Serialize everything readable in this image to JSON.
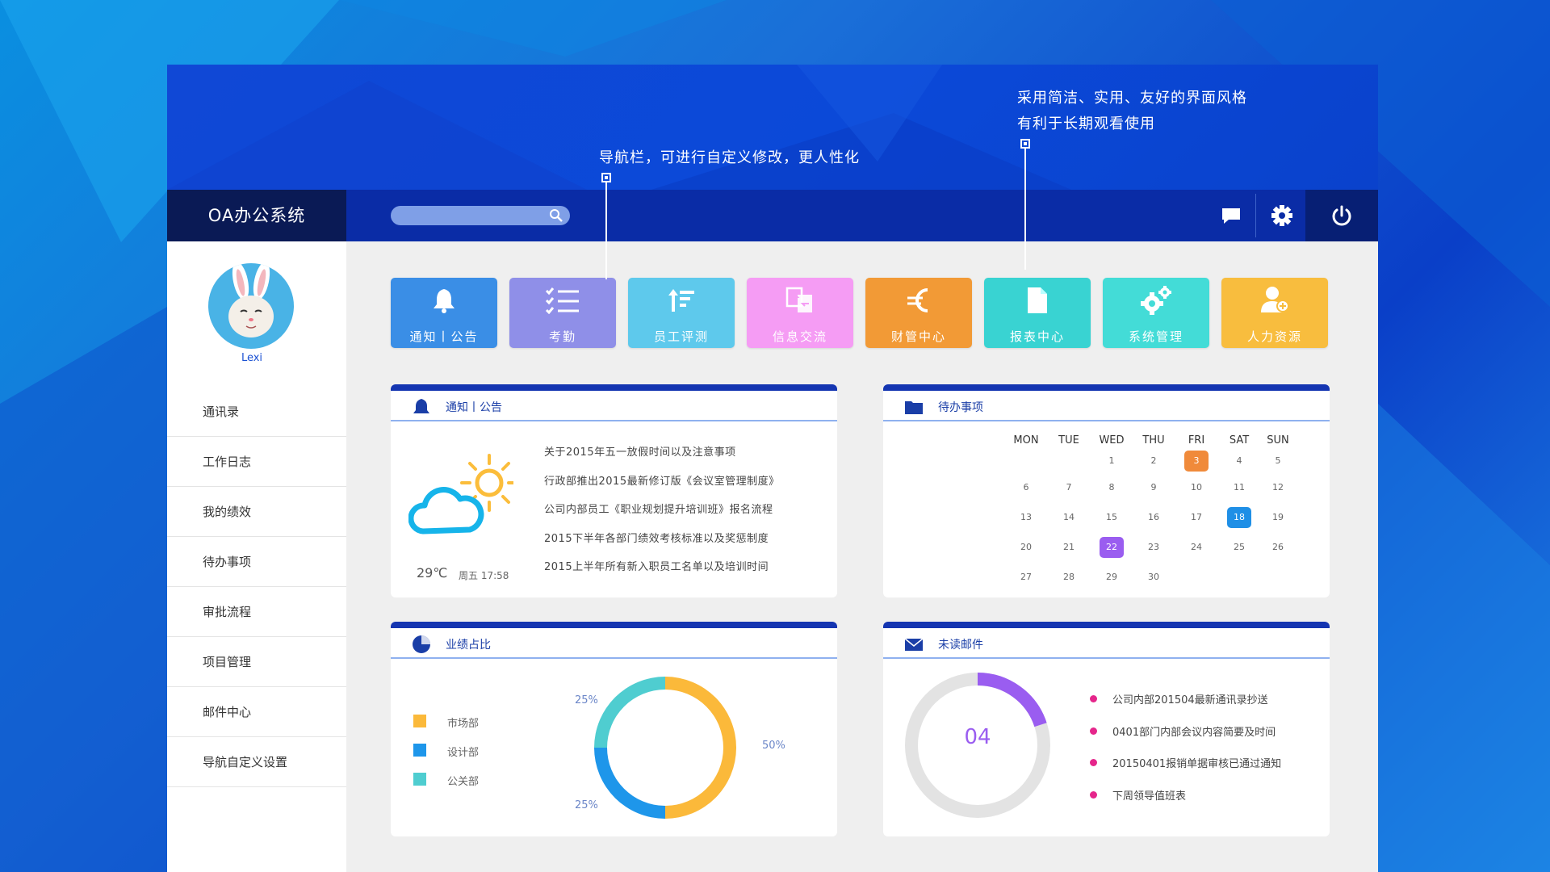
{
  "app": {
    "title": "OA办公系统"
  },
  "annotations": {
    "nav": "导航栏，可进行自定义修改，更人性化",
    "style_line1": "采用简洁、实用、友好的界面风格",
    "style_line2": "有利于长期观看使用"
  },
  "topbar": {
    "search_placeholder": "",
    "icons": [
      "search-icon",
      "chat-icon",
      "gear-icon",
      "power-icon"
    ]
  },
  "user": {
    "name": "Lexi"
  },
  "sidebar": {
    "items": [
      {
        "label": "通讯录"
      },
      {
        "label": "工作日志"
      },
      {
        "label": "我的绩效"
      },
      {
        "label": "待办事项"
      },
      {
        "label": "审批流程"
      },
      {
        "label": "项目管理"
      },
      {
        "label": "邮件中心"
      },
      {
        "label": "导航自定义设置"
      }
    ]
  },
  "tiles": [
    {
      "label": "通知丨公告",
      "color": "#3a8ee6",
      "icon": "bell-icon"
    },
    {
      "label": "考勤",
      "color": "#8f8fe8",
      "icon": "checklist-icon"
    },
    {
      "label": "员工评测",
      "color": "#5ec9ec",
      "icon": "sort-icon"
    },
    {
      "label": "信息交流",
      "color": "#f59cf4",
      "icon": "exchange-icon"
    },
    {
      "label": "财管中心",
      "color": "#f29a36",
      "icon": "euro-icon"
    },
    {
      "label": "报表中心",
      "color": "#39d3d2",
      "icon": "document-icon"
    },
    {
      "label": "系统管理",
      "color": "#43dcd7",
      "icon": "gears-icon"
    },
    {
      "label": "人力资源",
      "color": "#f8bd3e",
      "icon": "user-add-icon"
    }
  ],
  "notice": {
    "title": "通知丨公告",
    "weather": {
      "temp": "29℃",
      "time": "周五 17:58"
    },
    "items": [
      "关于2015年五一放假时间以及注意事项",
      "行政部推出2015最新修订版《会议室管理制度》",
      "公司内部员工《职业规划提升培训班》报名流程",
      "2015下半年各部门绩效考核标准以及奖惩制度",
      "2015上半年所有新入职员工名单以及培训时间"
    ]
  },
  "todo": {
    "title": "待办事项",
    "weekdays": [
      "MON",
      "TUE",
      "WED",
      "THU",
      "FRI",
      "SAT",
      "SUN"
    ],
    "weeks": [
      [
        "",
        "",
        "1",
        "2",
        "3",
        "4",
        "5"
      ],
      [
        "6",
        "7",
        "8",
        "9",
        "10",
        "11",
        "12"
      ],
      [
        "13",
        "14",
        "15",
        "16",
        "17",
        "18",
        "19"
      ],
      [
        "20",
        "21",
        "22",
        "23",
        "24",
        "25",
        "26"
      ],
      [
        "27",
        "28",
        "29",
        "30",
        "",
        "",
        ""
      ]
    ],
    "highlights": {
      "3": "#f08a3a",
      "18": "#1f8fe6",
      "22": "#9a5df0"
    }
  },
  "performance": {
    "title": "业绩占比",
    "legend": [
      {
        "label": "市场部",
        "color": "#fbb93a"
      },
      {
        "label": "设计部",
        "color": "#1e96ea"
      },
      {
        "label": "公关部",
        "color": "#4fcdd0"
      }
    ],
    "labels": {
      "top_left": "25%",
      "right": "50%",
      "bottom_left": "25%"
    },
    "chart_data": {
      "type": "pie",
      "categories": [
        "市场部",
        "设计部",
        "公关部"
      ],
      "values": [
        50,
        25,
        25
      ]
    }
  },
  "mail": {
    "title": "未读邮件",
    "count": "04",
    "progress": 0.2,
    "items": [
      "公司内部201504最新通讯录抄送",
      "0401部门内部会议内容简要及时间",
      "20150401报销单据审核已通过通知",
      "下周领导值班表"
    ]
  }
}
